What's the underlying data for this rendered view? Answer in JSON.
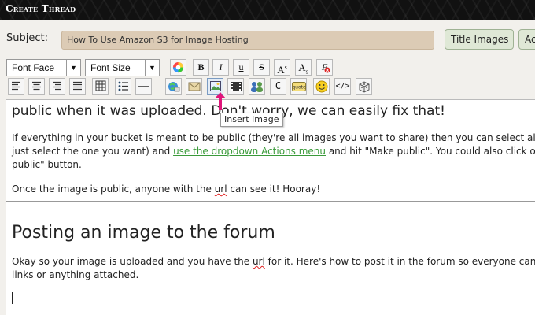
{
  "header": {
    "title": "Create Thread"
  },
  "subject": {
    "label": "Subject:",
    "value": "How To Use Amazon S3 for Image Hosting",
    "title_images_button": "Title Images",
    "next_button": "Ac"
  },
  "toolbar": {
    "font_face": "Font Face",
    "font_size": "Font Size",
    "tooltip": "Insert Image",
    "row1_buttons": [
      "color-wheel-icon",
      "bold-icon",
      "italic-icon",
      "underline-icon",
      "strikethrough-icon",
      "superscript-icon",
      "subscript-icon",
      "remove-format-icon"
    ],
    "bold": "B",
    "italic": "I",
    "underline": "u",
    "strike": "S",
    "sup": "A",
    "sup_s": "s",
    "sub": "A",
    "sub_s": "s",
    "remove": "F"
  },
  "editor": {
    "line1": "public when it was uploaded. Don't worry, we can easily fix that!",
    "p1_line1": "If everything in your bucket is meant to be public (they're all images you want to share) then you can select all",
    "p1_line2_a": "just select the one you want) and ",
    "p1_link": "use the dropdown Actions menu",
    "p1_line2_b": " and hit \"Make public\". You could also click or",
    "p1_line3": "public\" button.",
    "p2_a": "Once the image is public, anyone with the ",
    "p2_url": "url",
    "p2_b": " can see it! Hooray!",
    "heading": "Posting an image to the forum",
    "p3_a": "Okay so your image is uploaded and you have the ",
    "p3_url": "url",
    "p3_b": " for it. Here's how to post it in the forum so everyone can s",
    "p3_line2": "links or anything attached."
  }
}
